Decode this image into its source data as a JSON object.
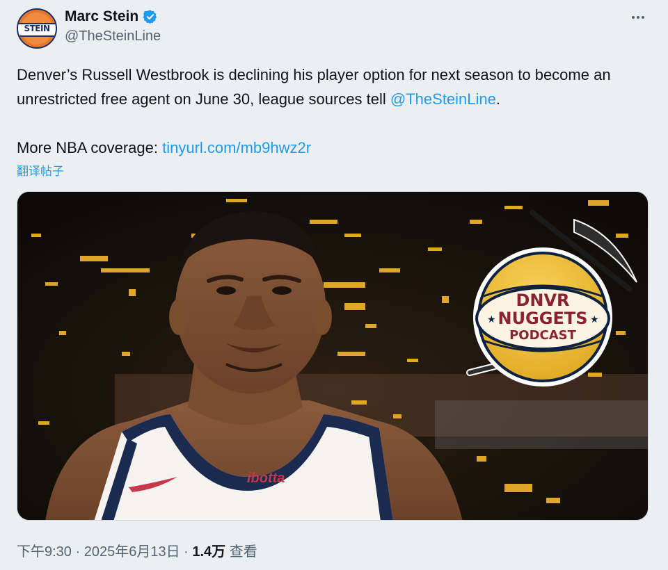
{
  "author": {
    "display_name": "Marc Stein",
    "handle": "@TheSteinLine",
    "avatar_text": "STEIN",
    "verified": true
  },
  "tweet": {
    "text_before": "Denver’s Russell Westbrook is declining his player option for next season to become an unrestricted free agent on June 30, league sources tell ",
    "mention": "@TheSteinLine",
    "text_after": ".",
    "coverage_label": "More NBA coverage: ",
    "coverage_link": "tinyurl.com/mb9hwz2r",
    "translate_label": "翻译帖子"
  },
  "media": {
    "logo_line1": "DNVR",
    "logo_line2": "NUGGETS",
    "logo_line3": "PODCAST",
    "jersey_text": "ibotta"
  },
  "footer": {
    "time": "下午9:30",
    "sep1": " · ",
    "date": "2025年6月13日",
    "sep2": " · ",
    "views_count": "1.4万",
    "views_label": " 查看"
  },
  "colors": {
    "link": "#1d9bf0",
    "verified": "#1d9bf0",
    "secondary_text": "#536471",
    "logo_gold": "#f2c43c",
    "logo_navy": "#0e2240",
    "logo_red": "#8b2131"
  },
  "icons": [
    "verified-badge-icon",
    "more-options-icon"
  ]
}
